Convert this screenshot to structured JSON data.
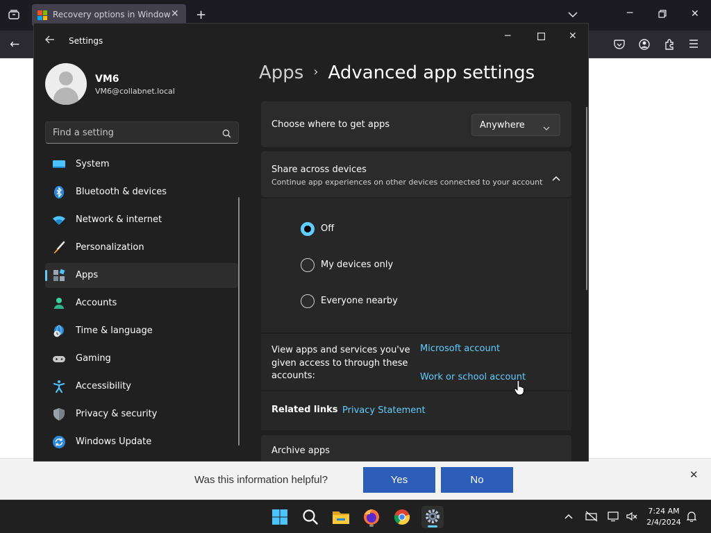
{
  "browser": {
    "tab_title": "Recovery options in Windows",
    "favicon_colors": [
      "#f25022",
      "#7fba00",
      "#00a4ef",
      "#ffb900"
    ]
  },
  "feedback": {
    "question": "Was this information helpful?",
    "yes_label": "Yes",
    "no_label": "No"
  },
  "settings": {
    "window_title": "Settings",
    "user": {
      "name": "VM6",
      "email": "VM6@collabnet.local"
    },
    "search_placeholder": "Find a setting",
    "nav": [
      {
        "label": "System",
        "icon": "monitor-icon"
      },
      {
        "label": "Bluetooth & devices",
        "icon": "bluetooth-icon"
      },
      {
        "label": "Network & internet",
        "icon": "wifi-icon"
      },
      {
        "label": "Personalization",
        "icon": "brush-icon"
      },
      {
        "label": "Apps",
        "icon": "apps-icon",
        "active": true
      },
      {
        "label": "Accounts",
        "icon": "person-icon"
      },
      {
        "label": "Time & language",
        "icon": "globe-clock-icon"
      },
      {
        "label": "Gaming",
        "icon": "gamepad-icon"
      },
      {
        "label": "Accessibility",
        "icon": "accessibility-icon"
      },
      {
        "label": "Privacy & security",
        "icon": "shield-icon"
      },
      {
        "label": "Windows Update",
        "icon": "update-icon"
      }
    ],
    "breadcrumb": {
      "parent": "Apps",
      "separator": "›",
      "current": "Advanced app settings"
    },
    "choose_apps": {
      "label": "Choose where to get apps",
      "value": "Anywhere"
    },
    "share": {
      "title": "Share across devices",
      "description": "Continue app experiences on other devices connected to your account",
      "options": [
        "Off",
        "My devices only",
        "Everyone nearby"
      ],
      "selected": "Off"
    },
    "accounts_access": {
      "text_lines": [
        "View apps and services you've",
        "given access to through these",
        "accounts:"
      ],
      "link_microsoft": "Microsoft account",
      "link_work": "Work or school account"
    },
    "related": {
      "label": "Related links",
      "link": "Privacy Statement"
    },
    "archive": {
      "title": "Archive apps"
    },
    "accent_color": "#60cdff"
  },
  "taskbar": {
    "time": "7:24 AM",
    "date": "2/4/2024",
    "apps": [
      "windows-start-icon",
      "search-icon",
      "file-explorer-icon",
      "firefox-icon",
      "chrome-icon",
      "settings-icon"
    ]
  }
}
